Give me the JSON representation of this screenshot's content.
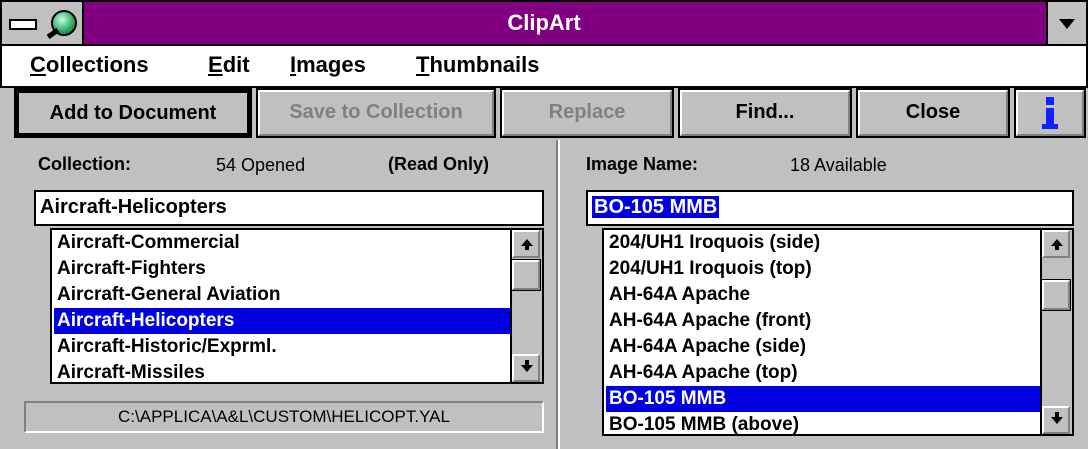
{
  "window": {
    "title": "ClipArt"
  },
  "menu": [
    "Collections",
    "Edit",
    "Images",
    "Thumbnails"
  ],
  "toolbar": {
    "add": "Add to Document",
    "save": "Save to Collection",
    "replace": "Replace",
    "find": "Find...",
    "close": "Close",
    "info_icon": "info-icon"
  },
  "collection": {
    "label": "Collection:",
    "count": "54 Opened",
    "status": "(Read Only)",
    "current": "Aircraft-Helicopters",
    "items": [
      "Aircraft-Commercial",
      "Aircraft-Fighters",
      "Aircraft-General Aviation",
      "Aircraft-Helicopters",
      "Aircraft-Historic/Exprml.",
      "Aircraft-Missiles"
    ],
    "selected_index": 3,
    "path": "C:\\APPLICA\\A&L\\CUSTOM\\HELICOPT.YAL"
  },
  "image": {
    "label": "Image Name:",
    "count": "18 Available",
    "current": "BO-105 MMB",
    "items": [
      "204/UH1 Iroquois (side)",
      "204/UH1 Iroquois (top)",
      "AH-64A Apache",
      "AH-64A Apache (front)",
      "AH-64A Apache (side)",
      "AH-64A Apache (top)",
      "BO-105 MMB",
      "BO-105 MMB (above)"
    ],
    "selected_index": 6
  },
  "colors": {
    "title_bar": "#800080",
    "selection": "#0000e0",
    "face": "#c0c0c0"
  }
}
